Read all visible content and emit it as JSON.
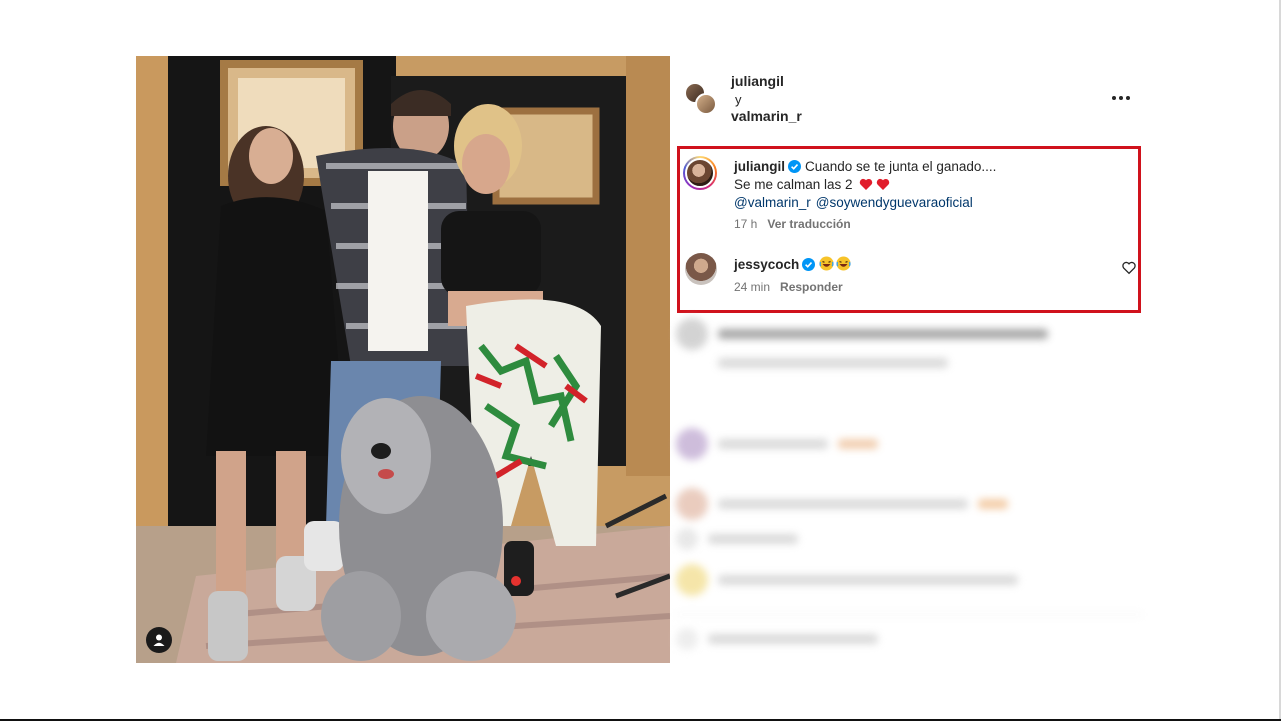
{
  "post": {
    "owner_1": "juliangil",
    "conjunction": "y",
    "owner_2": "valmarin_r"
  },
  "caption": {
    "username": "juliangil",
    "text": "Cuando se te junta el ganado....",
    "line2": "Se me calman las 2",
    "mention_1": "@valmarin_r",
    "mention_2": "@soywendyguevaraoficial",
    "time": "17 h",
    "translate_label": "Ver traducción"
  },
  "comment": {
    "username": "jessycoch",
    "time": "24 min",
    "reply_label": "Responder"
  },
  "colors": {
    "highlight": "#d0121c",
    "verified": "#0095f6",
    "link": "#00376b",
    "heart": "#e11d2b"
  },
  "icons": {
    "more": "more-icon",
    "verified": "verified-badge-icon",
    "heart": "heart-icon",
    "tag": "user-tag-icon",
    "emoji": "laughing-emoji-icon"
  }
}
